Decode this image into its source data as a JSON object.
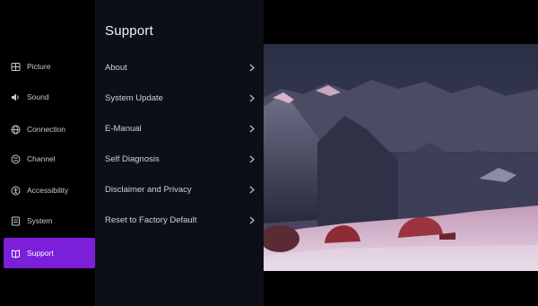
{
  "sidebar": {
    "items": [
      {
        "label": "Picture",
        "icon": "picture-icon",
        "active": false
      },
      {
        "label": "Sound",
        "icon": "sound-icon",
        "active": false
      },
      {
        "label": "Connection",
        "icon": "globe-icon",
        "active": false
      },
      {
        "label": "Channel",
        "icon": "channel-icon",
        "active": false
      },
      {
        "label": "Accessibility",
        "icon": "accessibility-icon",
        "active": false
      },
      {
        "label": "System",
        "icon": "system-icon",
        "active": false
      },
      {
        "label": "Support",
        "icon": "support-icon",
        "active": true
      }
    ]
  },
  "panel": {
    "title": "Support",
    "items": [
      {
        "label": "About"
      },
      {
        "label": "System Update"
      },
      {
        "label": "E-Manual"
      },
      {
        "label": "Self Diagnosis"
      },
      {
        "label": "Disclaimer and Privacy"
      },
      {
        "label": "Reset to Factory Default"
      }
    ]
  },
  "preview": {
    "image": "mountain-camp-photo"
  },
  "colors": {
    "accent": "#7b1fd8",
    "panel_bg": "#0d0f16",
    "background": "#000000"
  }
}
